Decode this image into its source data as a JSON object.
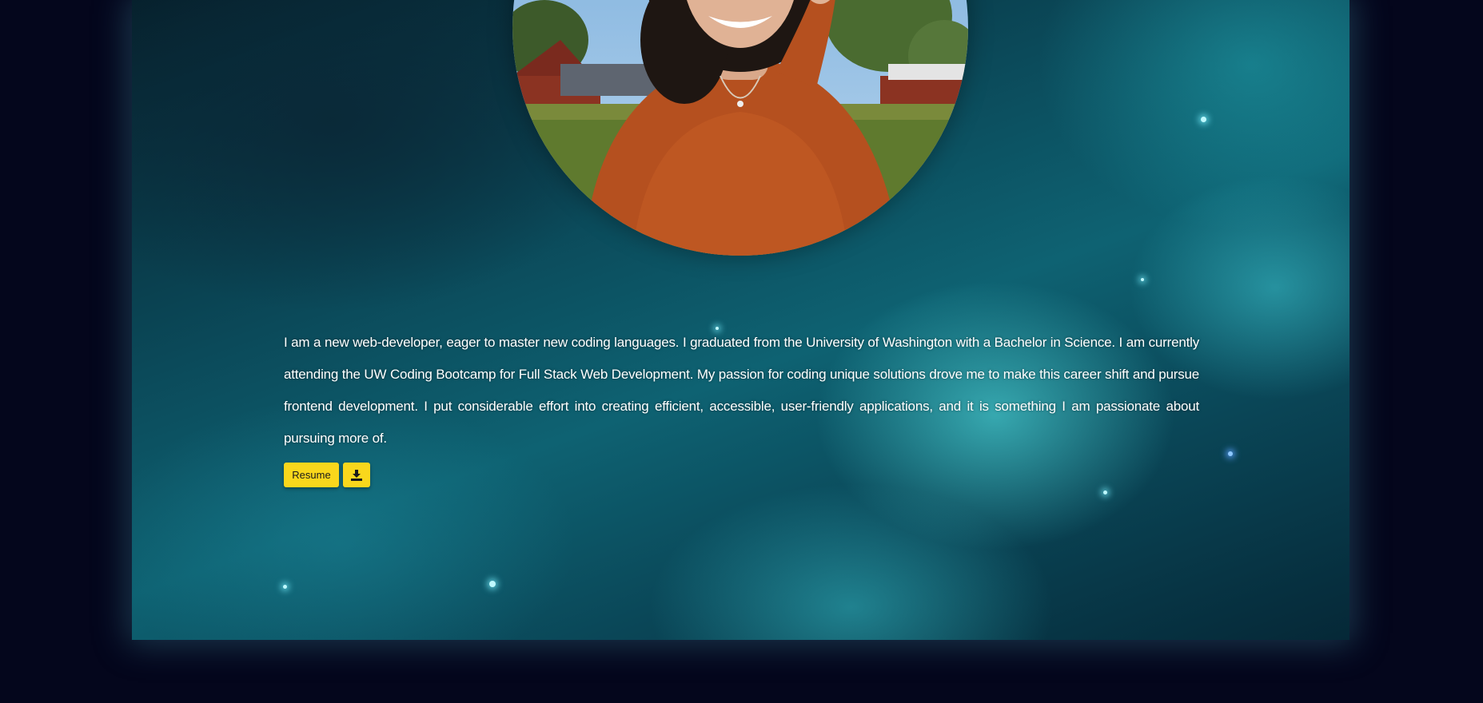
{
  "about": {
    "bio": "I am a new web-developer, eager to master new coding languages. I graduated from the University of Washington with a Bachelor in Science. I am currently attending the UW Coding Bootcamp for Full Stack Web Development. My passion for coding unique solutions drove me to make this career shift and pursue frontend development. I put considerable effort into creating efficient, accessible, user-friendly applications, and it is something I am passionate about pursuing more of.",
    "resume_button_label": "Resume",
    "download_icon": "download-icon"
  },
  "colors": {
    "page_background": "#04061c",
    "button_background": "#f9d71c",
    "text": "#ffffff"
  }
}
